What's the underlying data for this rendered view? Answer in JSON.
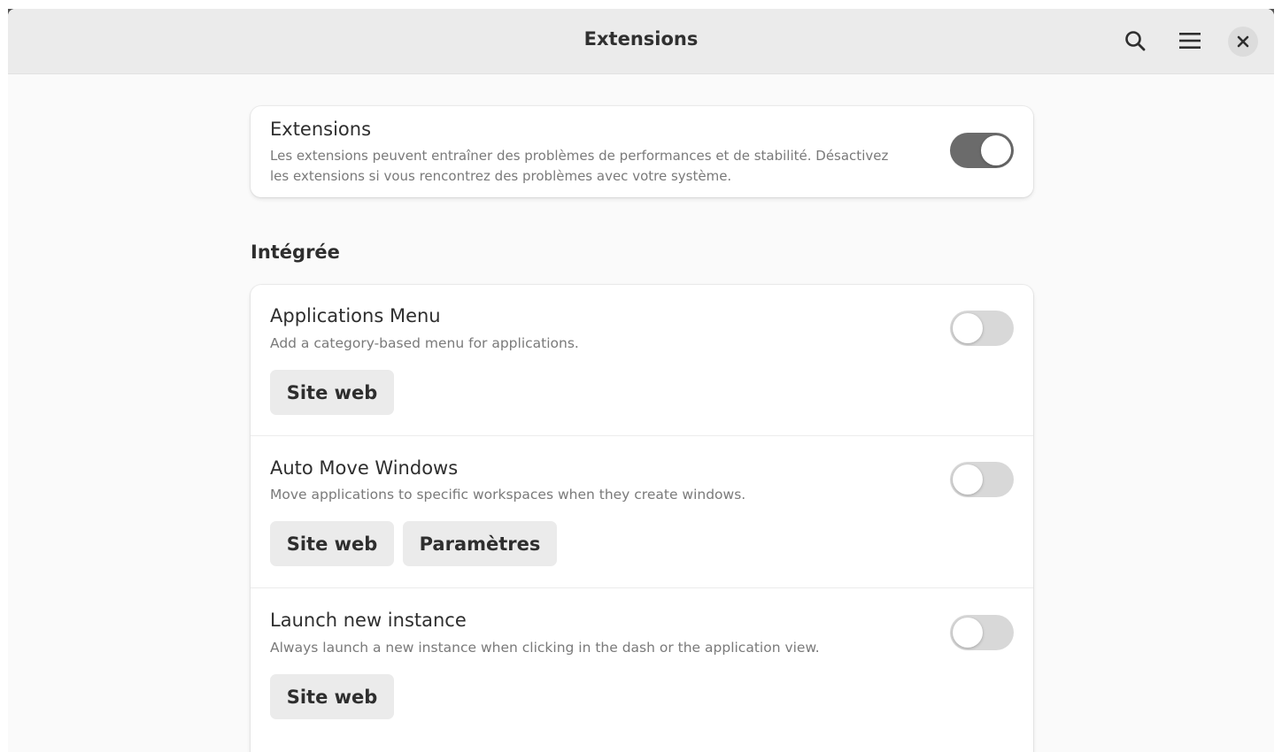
{
  "window": {
    "title": "Extensions",
    "search_icon": "search-icon",
    "menu_icon": "hamburger-menu-icon",
    "close_icon": "close-icon"
  },
  "master": {
    "title": "Extensions",
    "description_line1": "Les extensions peuvent entraîner des problèmes de performances et de stabilité. Désactivez",
    "description_line2": "les extensions si vous rencontrez des problèmes avec votre système.",
    "enabled": true
  },
  "section": {
    "title": "Intégrée"
  },
  "extensions": [
    {
      "title": "Applications Menu",
      "description": "Add a category-based menu for applications.",
      "enabled": false,
      "website_label": "Site web"
    },
    {
      "title": "Auto Move Windows",
      "description": "Move applications to specific workspaces when they create windows.",
      "enabled": false,
      "website_label": "Site web",
      "settings_label": "Paramètres"
    },
    {
      "title": "Launch new instance",
      "description": "Always launch a new instance when clicking in the dash or the application view.",
      "enabled": false,
      "website_label": "Site web"
    }
  ],
  "colors": {
    "toggle_on": "#6b6b6b",
    "toggle_off": "#d8d8d8",
    "headerbar": "#ebebeb"
  }
}
